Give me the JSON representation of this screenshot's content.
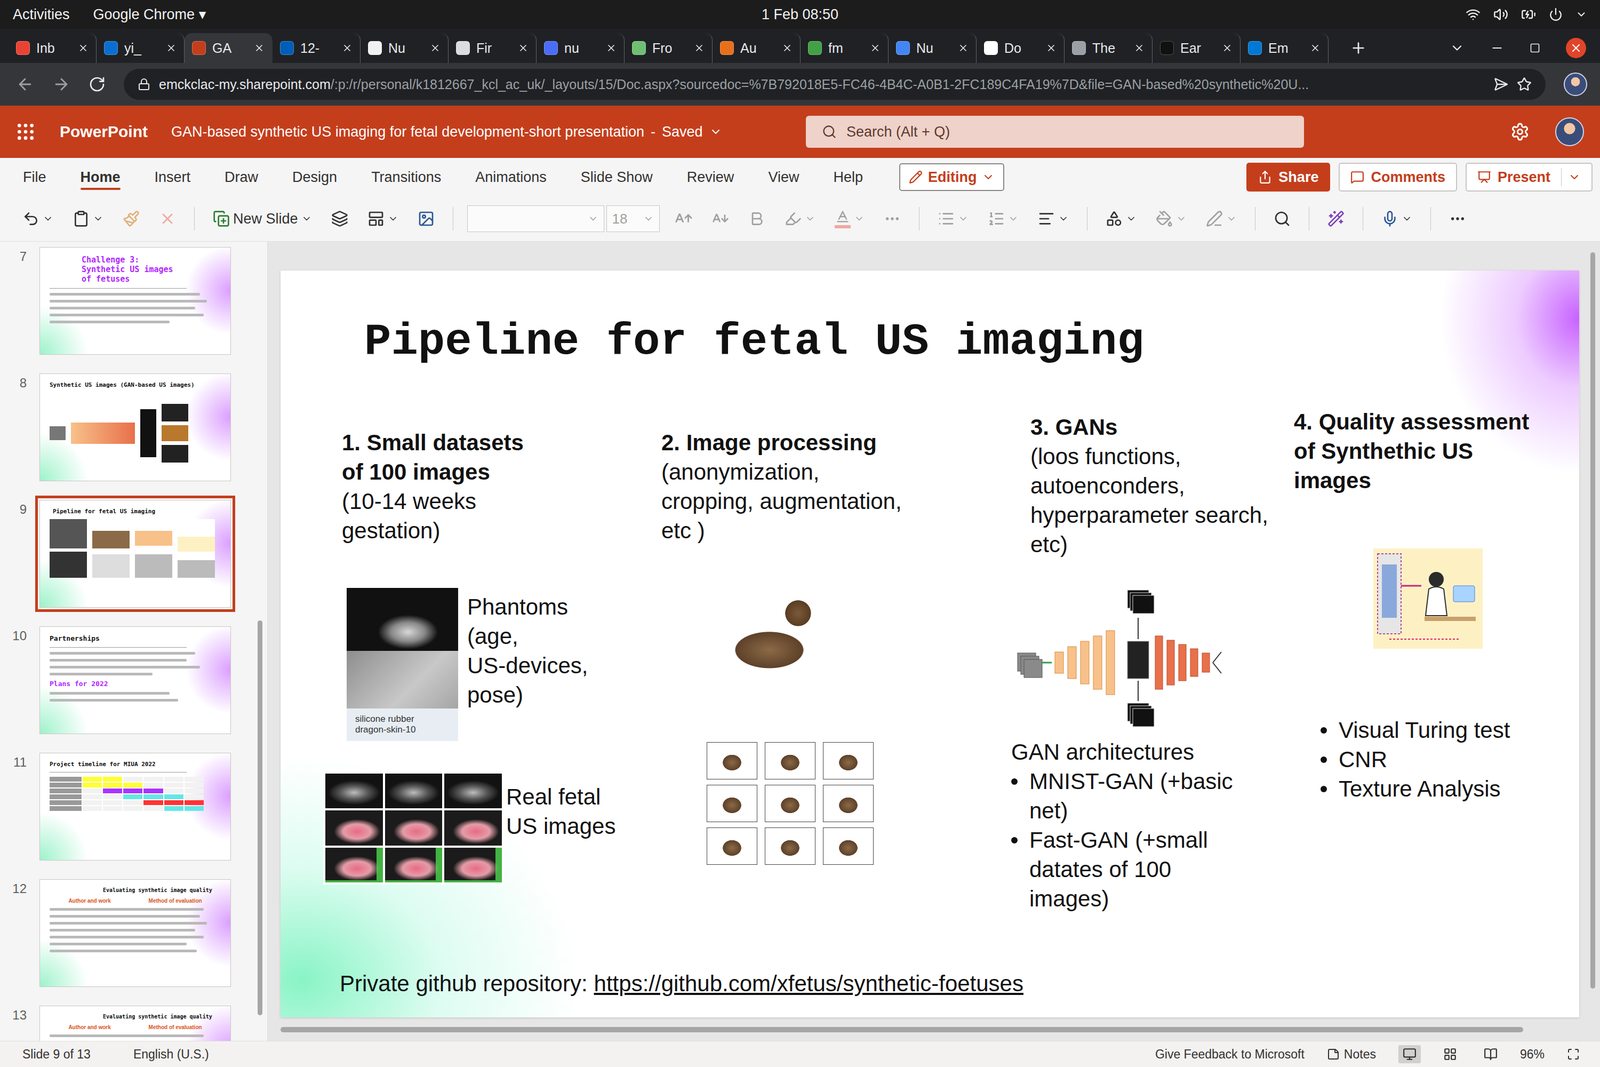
{
  "system_bar": {
    "activities": "Activities",
    "app_menu": "Google Chrome",
    "app_menu_arrow": "▾",
    "clock": "1 Feb  08:50"
  },
  "browser_tabs": [
    {
      "label": "Inb",
      "selected": false,
      "color": "#ea4335"
    },
    {
      "label": "yi_",
      "selected": false,
      "color": "#0a6ed1"
    },
    {
      "label": "GA",
      "selected": true,
      "color": "#c43e1c"
    },
    {
      "label": "12-",
      "selected": false,
      "color": "#005eb8"
    },
    {
      "label": "Nu",
      "selected": false,
      "color": "#f1f1f1"
    },
    {
      "label": "Fir",
      "selected": false,
      "color": "#dadce0"
    },
    {
      "label": "nu",
      "selected": false,
      "color": "#4a6cf7"
    },
    {
      "label": "Fro",
      "selected": false,
      "color": "#6fbf73"
    },
    {
      "label": "Au",
      "selected": false,
      "color": "#e8701a"
    },
    {
      "label": "fm",
      "selected": false,
      "color": "#43a047"
    },
    {
      "label": "Nu",
      "selected": false,
      "color": "#4285f4"
    },
    {
      "label": "Do",
      "selected": false,
      "color": "#ffffff"
    },
    {
      "label": "The",
      "selected": false,
      "color": "#9aa0a6"
    },
    {
      "label": "Ear",
      "selected": false,
      "color": "#111111"
    },
    {
      "label": "Em",
      "selected": false,
      "color": "#0078d4"
    }
  ],
  "address_bar": {
    "host": "emckclac-my.sharepoint.com",
    "path": "/:p:/r/personal/k1812667_kcl_ac_uk/_layouts/15/Doc.aspx?sourcedoc=%7B792018E5-FC46-4B4C-A0B1-2FC189C4FA19%7D&file=GAN-based%20synthetic%20U..."
  },
  "app_header": {
    "app": "PowerPoint",
    "document": "GAN-based synthetic US imaging for fetal development-short presentation",
    "separator": "-",
    "save_state": "Saved",
    "search_placeholder": "Search (Alt + Q)"
  },
  "ribbon_tabs": [
    {
      "label": "File",
      "selected": false
    },
    {
      "label": "Home",
      "selected": true
    },
    {
      "label": "Insert",
      "selected": false
    },
    {
      "label": "Draw",
      "selected": false
    },
    {
      "label": "Design",
      "selected": false
    },
    {
      "label": "Transitions",
      "selected": false
    },
    {
      "label": "Animations",
      "selected": false
    },
    {
      "label": "Slide Show",
      "selected": false
    },
    {
      "label": "Review",
      "selected": false
    },
    {
      "label": "View",
      "selected": false
    },
    {
      "label": "Help",
      "selected": false
    }
  ],
  "ribbon_actions": {
    "mode": "Editing",
    "share": "Share",
    "comments": "Comments",
    "present": "Present"
  },
  "toolbar": {
    "new_slide": "New Slide",
    "font_name": "",
    "font_size": "18",
    "format_painter_disabled": true,
    "clear_disabled": true,
    "font_controls_disabled": true
  },
  "thumbnails": [
    {
      "number": "7",
      "selected": false,
      "kind": "text",
      "title": [
        "Challenge 3:",
        "Synthetic US images",
        "of fetuses"
      ],
      "title_color": "#b026ff"
    },
    {
      "number": "8",
      "selected": false,
      "kind": "figure",
      "title": [
        "Synthetic US images (GAN-based US images)"
      ],
      "title_color": "#111111"
    },
    {
      "number": "9",
      "selected": true,
      "kind": "pipeline",
      "title": [
        "Pipeline for fetal US imaging"
      ],
      "title_color": "#111111"
    },
    {
      "number": "10",
      "selected": false,
      "kind": "partners",
      "title": [
        "Partnerships"
      ],
      "title_color": "#111111",
      "subtitle": "Plans for 2022"
    },
    {
      "number": "11",
      "selected": false,
      "kind": "timeline",
      "title": [
        "Project timeline for MIUA 2022"
      ],
      "title_color": "#111111"
    },
    {
      "number": "12",
      "selected": false,
      "kind": "table",
      "title": [
        "Evaluating synthetic image quality"
      ],
      "title_color": "#111111",
      "columns": [
        "Author and work",
        "Method of evaluation"
      ]
    },
    {
      "number": "13",
      "selected": false,
      "kind": "table",
      "title": [
        "Evaluating synthetic image quality"
      ],
      "title_color": "#111111",
      "columns": [
        "Author and work",
        "Method of evaluation"
      ]
    }
  ],
  "slide": {
    "title": "Pipeline for fetal US imaging",
    "datasets": {
      "heading": [
        "1. Small datasets",
        "of 100 images"
      ],
      "detail": [
        "(10-14 weeks",
        "gestation)"
      ],
      "phantom_caption": [
        "silicone rubber",
        "dragon-skin-10"
      ],
      "phantom_label": [
        "Phantoms",
        "(age,",
        "US-devices,",
        "pose)"
      ],
      "real_label": [
        "Real fetal",
        "US images"
      ]
    },
    "processing": {
      "heading": [
        "2. Image processing"
      ],
      "detail": [
        "(anonymization,",
        "cropping, augmentation,",
        "etc )"
      ]
    },
    "gans": {
      "heading": [
        "3. GANs"
      ],
      "detail": [
        "(loos functions,",
        "autoenconders,",
        "hyperparameter search,",
        "etc)"
      ],
      "architectures_title": "GAN architectures",
      "architectures": [
        [
          "MNIST-GAN (+basic",
          "net)"
        ],
        [
          "Fast-GAN (+small",
          "datates of 100",
          "images)"
        ]
      ]
    },
    "quality": {
      "heading": [
        "4. Quality assessment",
        "of Synthethic US",
        "images"
      ],
      "metrics": [
        "Visual Turing test",
        "CNR",
        "Texture Analysis"
      ]
    },
    "footer": {
      "label": "Private github repository:",
      "link": "https://github.com/xfetus/synthetic-foetuses"
    }
  },
  "status_bar": {
    "slide_counter": "Slide 9 of 13",
    "language": "English (U.S.)",
    "feedback": "Give Feedback to Microsoft",
    "notes": "Notes",
    "zoom": "96%"
  }
}
